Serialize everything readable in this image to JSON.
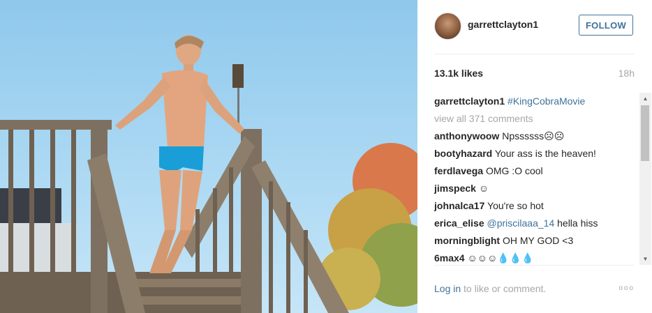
{
  "header": {
    "username": "garrettclayton1",
    "follow_label": "FOLLOW"
  },
  "stats": {
    "likes": "13.1k likes",
    "time": "18h"
  },
  "caption": {
    "username": "garrettclayton1",
    "text": "#KingCobraMovie"
  },
  "view_all": "view all 371 comments",
  "comments": [
    {
      "user": "anthonywoow",
      "text": "Npssssss☹☹"
    },
    {
      "user": "bootyhazard",
      "text": "Your ass is the heaven!"
    },
    {
      "user": "ferdlavega",
      "text": "OMG :O cool"
    },
    {
      "user": "jimspeck",
      "text": "☺"
    },
    {
      "user": "johnalca17",
      "text": "You're so hot"
    },
    {
      "user": "erica_elise",
      "mention": "@priscilaaa_14",
      "text": "hella hiss"
    },
    {
      "user": "morningblight",
      "text": "OH MY GOD <3"
    },
    {
      "user": "6max4",
      "text": "☺☺☺💧💧💧"
    }
  ],
  "footer": {
    "login_link": "Log in",
    "login_rest": " to like or comment.",
    "more": "ooo"
  },
  "colors": {
    "link": "#3f729b",
    "muted": "#a5a7aa",
    "text": "#262626"
  }
}
